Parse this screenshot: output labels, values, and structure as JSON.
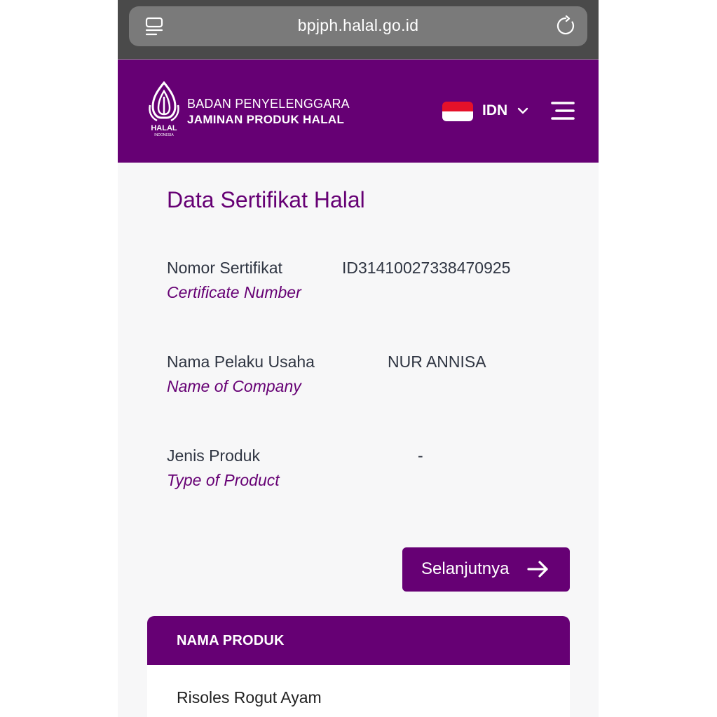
{
  "browser": {
    "url": "bpjph.halal.go.id"
  },
  "header": {
    "org_line1": "BADAN PENYELENGGARA",
    "org_line2": "JAMINAN PRODUK HALAL",
    "logo_text": "HALAL",
    "logo_subtext": "INDONESIA",
    "language": "IDN",
    "brand_color": "#660074"
  },
  "page": {
    "title": "Data Sertifikat Halal"
  },
  "fields": [
    {
      "label": "Nomor Sertifikat",
      "sub_label": "Certificate Number",
      "value": "ID31410027338470925"
    },
    {
      "label": "Nama Pelaku Usaha",
      "sub_label": "Name of Company",
      "value": "NUR ANNISA"
    },
    {
      "label": "Jenis Produk",
      "sub_label": "Type of Product",
      "value": "-"
    }
  ],
  "next_button": {
    "label": "Selanjutnya"
  },
  "products": {
    "header": "NAMA PRODUK",
    "items": [
      "Risoles Rogut Ayam"
    ]
  }
}
